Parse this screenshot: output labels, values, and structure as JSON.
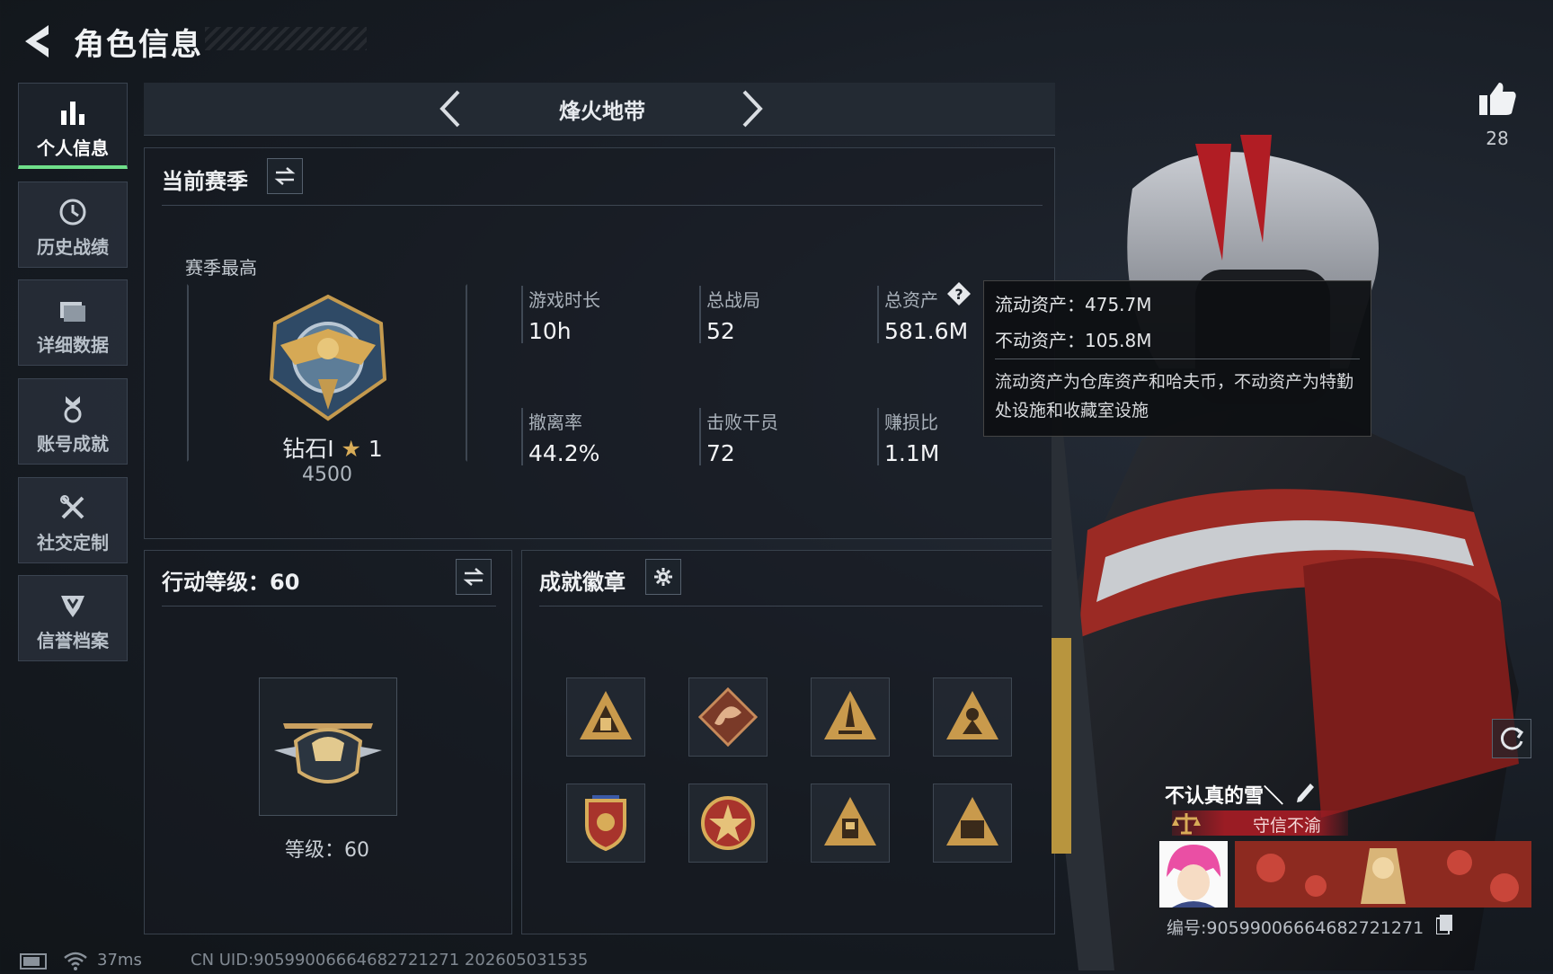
{
  "header": {
    "title": "角色信息"
  },
  "sidebar": {
    "items": [
      {
        "label": "个人信息",
        "icon": "bar-chart-icon"
      },
      {
        "label": "历史战绩",
        "icon": "history-icon"
      },
      {
        "label": "详细数据",
        "icon": "folder-icon"
      },
      {
        "label": "账号成就",
        "icon": "medal-icon"
      },
      {
        "label": "社交定制",
        "icon": "tools-icon"
      },
      {
        "label": "信誉档案",
        "icon": "shield-icon"
      }
    ]
  },
  "mode": {
    "name": "烽火地带"
  },
  "season": {
    "title": "当前赛季",
    "best_label": "赛季最高",
    "rank_name": "钻石I",
    "rank_stars": "1",
    "rank_score": "4500",
    "stats": [
      {
        "label": "游戏时长",
        "value": "10h"
      },
      {
        "label": "总战局",
        "value": "52"
      },
      {
        "label": "总资产",
        "value": "581.6M"
      },
      {
        "label": "撤离率",
        "value": "44.2%"
      },
      {
        "label": "击败干员",
        "value": "72"
      },
      {
        "label": "赚损比",
        "value": "1.1M"
      }
    ]
  },
  "tooltip": {
    "liquid": "流动资产：475.7M",
    "fixed": "不动资产：105.8M",
    "note": "流动资产为仓库资产和哈夫币，不动资产为特勤处设施和收藏室设施"
  },
  "action_level": {
    "title": "行动等级：60",
    "level_text": "等级：60"
  },
  "achievements": {
    "title": "成就徽章"
  },
  "player": {
    "likes": "28",
    "name": "不认真的雪＼",
    "trust_title": "守信不渝",
    "id_text": "编号:905990066646827212​71"
  },
  "footer": {
    "ping": "37ms",
    "uid": "CN UID:905990066646827212​71 202605031535"
  },
  "colors": {
    "accent_green": "#6fdf8a",
    "gold": "#d8ac58",
    "trust_red": "#9a1c24"
  }
}
